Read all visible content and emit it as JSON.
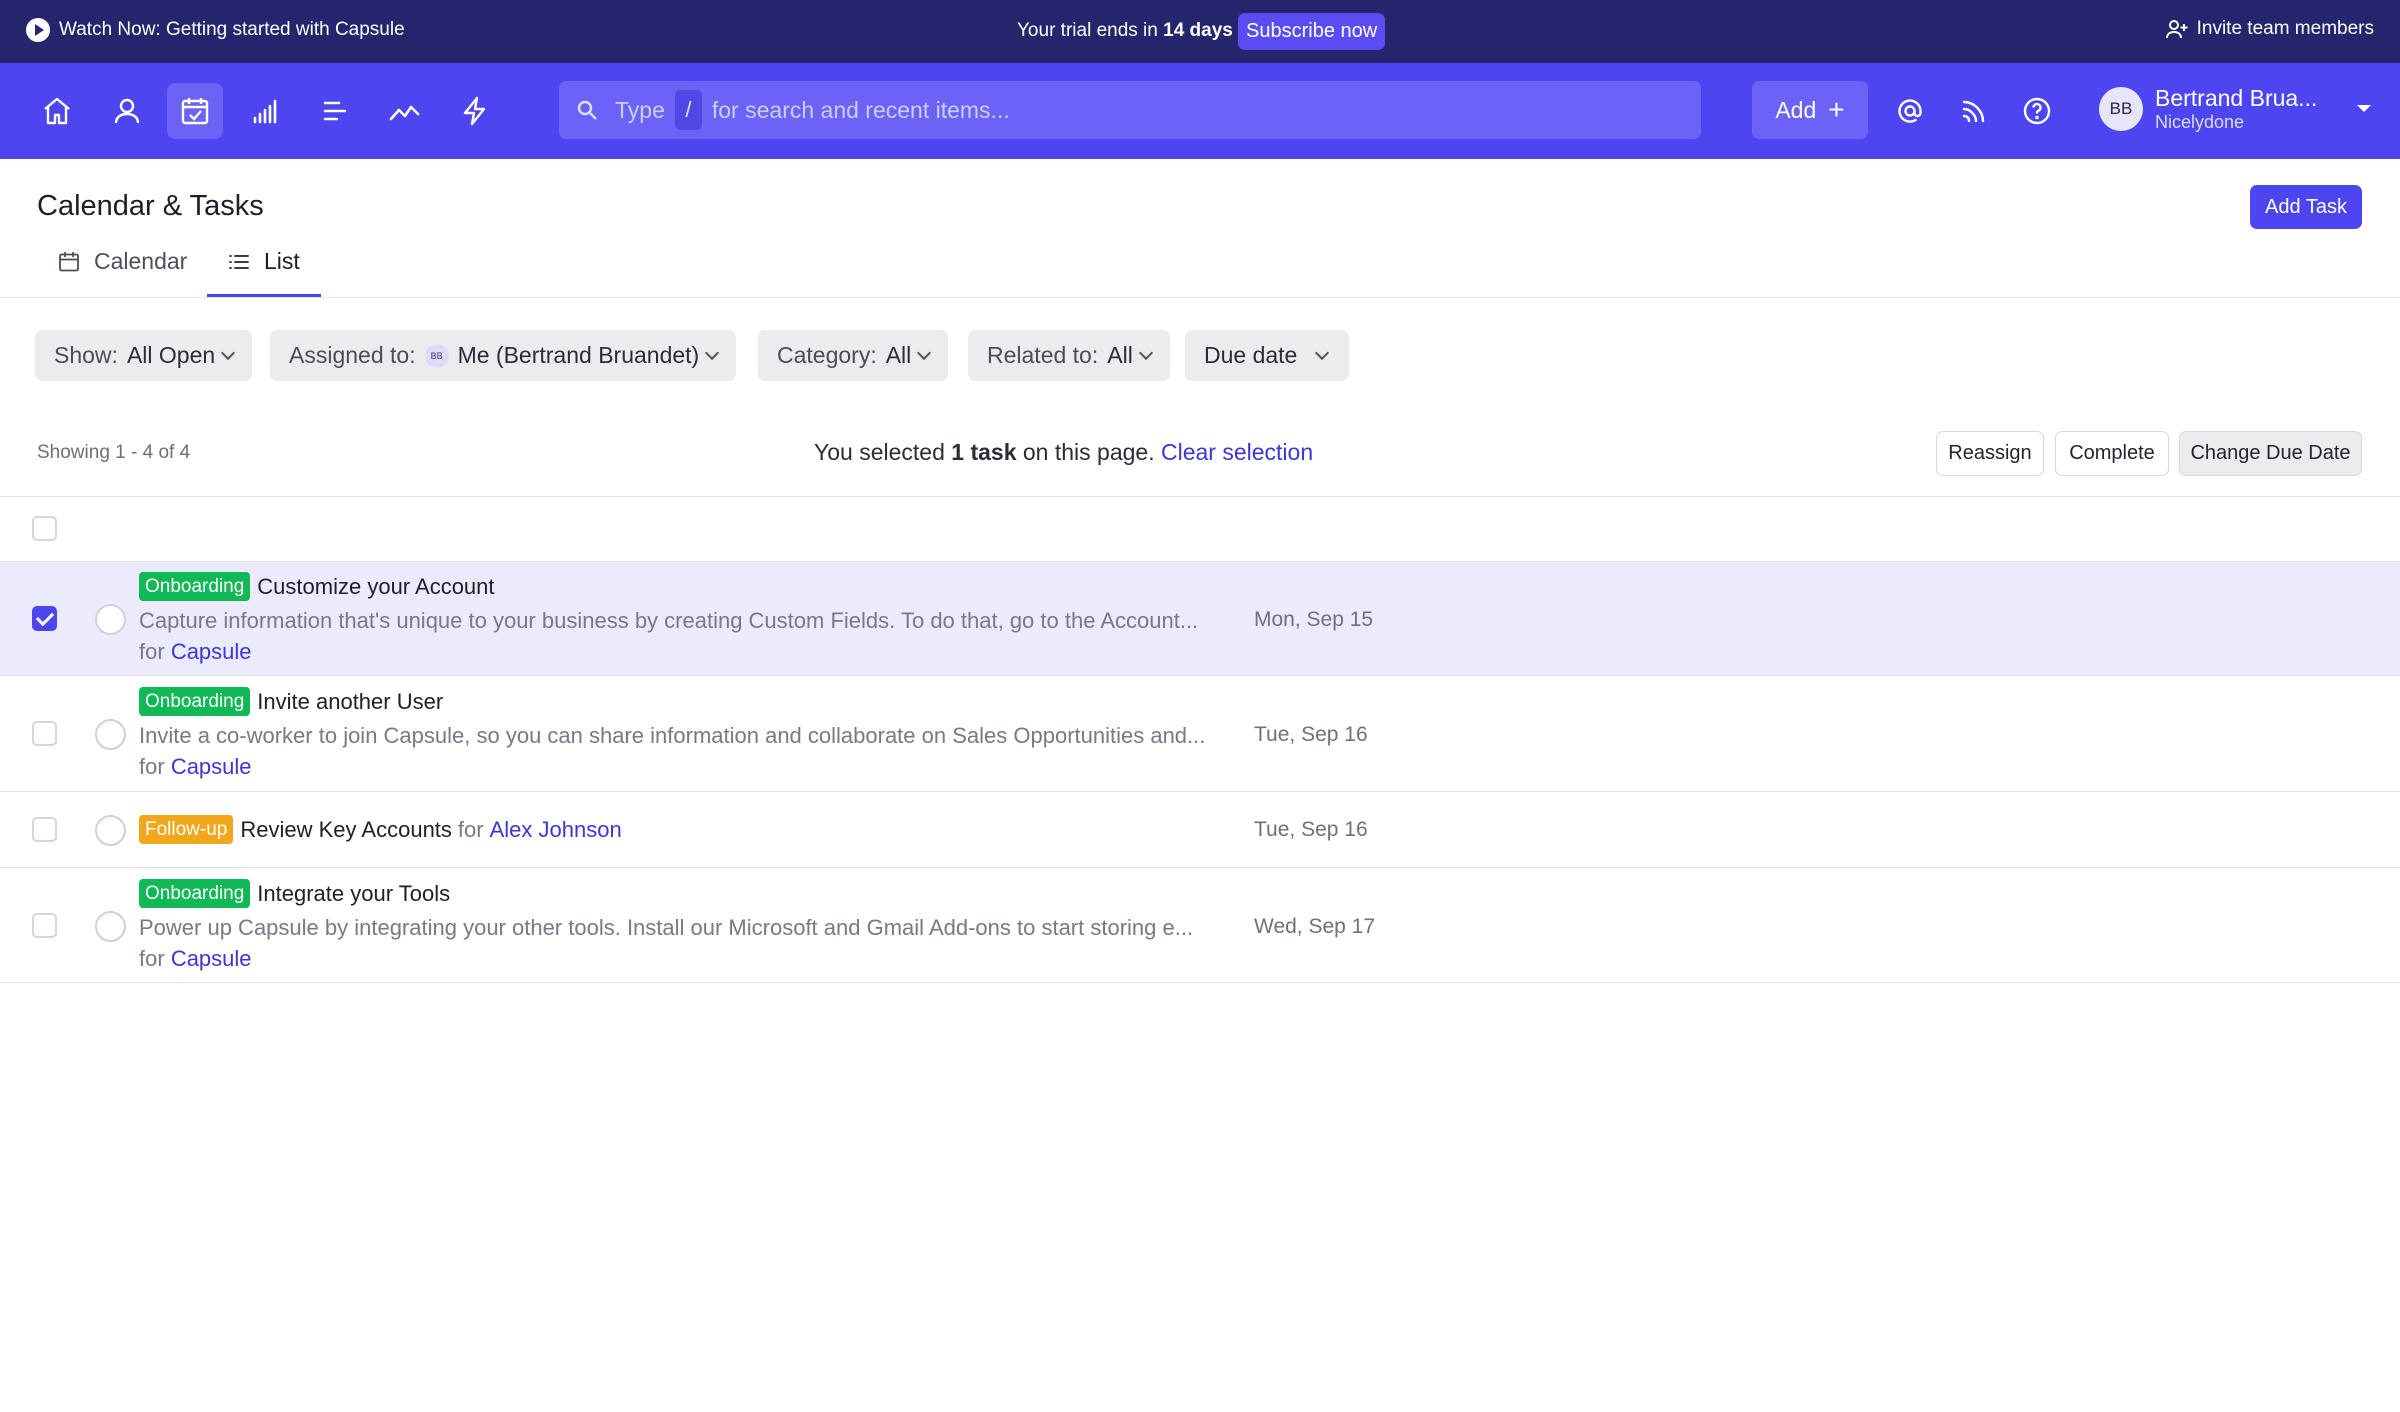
{
  "announcement": {
    "watch_text": "Watch Now: Getting started with Capsule",
    "trial_prefix": "Your trial ends in",
    "trial_days": "14 days",
    "subscribe_label": "Subscribe now",
    "invite_label": "Invite team members"
  },
  "nav": {
    "icons": [
      "home-icon",
      "person-icon",
      "calendar-check-icon",
      "bar-chart-icon",
      "list-icon",
      "trend-icon",
      "bolt-icon"
    ],
    "active_icon": "calendar-check-icon",
    "search": {
      "prefix": "Type",
      "slash": "/",
      "suffix": "for search and recent items..."
    },
    "add_label": "Add",
    "user": {
      "initials": "BB",
      "name": "Bertrand Brua...",
      "org": "Nicelydone"
    }
  },
  "page": {
    "title": "Calendar & Tasks",
    "add_task_label": "Add Task",
    "tabs": [
      {
        "label": "Calendar",
        "icon": "calendar-icon",
        "active": false
      },
      {
        "label": "List",
        "icon": "list-icon",
        "active": true
      }
    ]
  },
  "filters": {
    "show": {
      "label": "Show:",
      "value": "All Open"
    },
    "assigned": {
      "label": "Assigned to:",
      "avatar": "BB",
      "value": "Me (Bertrand Bruandet)"
    },
    "category": {
      "label": "Category:",
      "value": "All"
    },
    "related": {
      "label": "Related to:",
      "value": "All"
    },
    "due": {
      "label": "Due date"
    }
  },
  "selection": {
    "showing": "Showing 1 - 4 of 4",
    "msg_prefix": "You selected",
    "msg_count": "1 task",
    "msg_suffix": "on this page.",
    "clear_label": "Clear selection",
    "actions": {
      "reassign": "Reassign",
      "complete": "Complete",
      "change_due": "Change Due Date"
    }
  },
  "tasks": [
    {
      "tag": "Onboarding",
      "title": "Customize your Account",
      "description": "Capture information that's unique to your business by creating Custom Fields. To do that, go to the Account...",
      "for_label": "for",
      "for_link": "Capsule",
      "due": "Mon, Sep 15",
      "selected": true
    },
    {
      "tag": "Onboarding",
      "title": "Invite another User",
      "description": "Invite a co-worker to join Capsule, so you can share information and collaborate on Sales Opportunities and...",
      "for_label": "for",
      "for_link": "Capsule",
      "due": "Tue, Sep 16",
      "selected": false
    },
    {
      "tag": "Follow-up",
      "title": "Review Key Accounts",
      "for_label": "for",
      "for_link": "Alex Johnson",
      "due": "Tue, Sep 16",
      "selected": false
    },
    {
      "tag": "Onboarding",
      "title": "Integrate your Tools",
      "description": "Power up Capsule by integrating your other tools. Install our Microsoft and Gmail Add-ons to start storing e...",
      "for_label": "for",
      "for_link": "Capsule",
      "due": "Wed, Sep 17",
      "selected": false
    }
  ],
  "colors": {
    "announce_bg": "#25256e",
    "nav_bg": "#4d46f0",
    "accent": "#4d46f0",
    "onboarding_tag": "#10b955",
    "followup_tag": "#f1a71b",
    "selected_row": "#ecebfd"
  }
}
